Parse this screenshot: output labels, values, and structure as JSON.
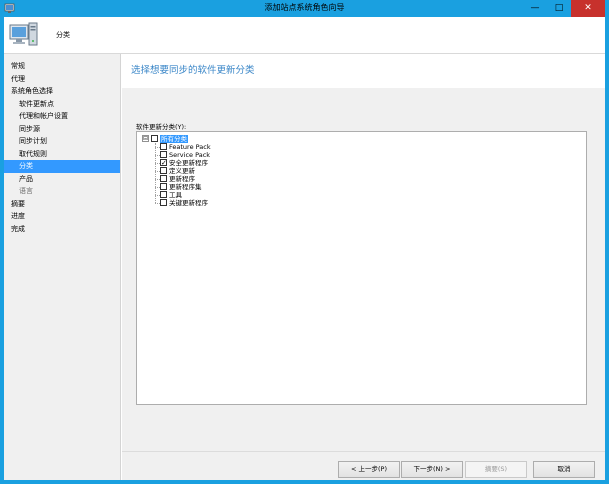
{
  "window": {
    "title": "添加站点系统角色向导",
    "controls": {
      "minimize": "—",
      "maximize": "□",
      "close": "✕"
    }
  },
  "header": {
    "title": "分类",
    "icon": "computer-wizard-icon"
  },
  "nav": {
    "items": [
      {
        "label": "常规",
        "level": 0,
        "state": "normal"
      },
      {
        "label": "代理",
        "level": 0,
        "state": "normal"
      },
      {
        "label": "系统角色选择",
        "level": 0,
        "state": "normal"
      },
      {
        "label": "软件更新点",
        "level": 1,
        "state": "normal"
      },
      {
        "label": "代理和帐户设置",
        "level": 1,
        "state": "normal"
      },
      {
        "label": "同步源",
        "level": 1,
        "state": "normal"
      },
      {
        "label": "同步计划",
        "level": 1,
        "state": "normal"
      },
      {
        "label": "取代规则",
        "level": 1,
        "state": "normal"
      },
      {
        "label": "分类",
        "level": 1,
        "state": "selected"
      },
      {
        "label": "产品",
        "level": 1,
        "state": "normal"
      },
      {
        "label": "语言",
        "level": 1,
        "state": "dim"
      },
      {
        "label": "摘要",
        "level": 0,
        "state": "normal"
      },
      {
        "label": "进度",
        "level": 0,
        "state": "normal"
      },
      {
        "label": "完成",
        "level": 0,
        "state": "normal"
      }
    ]
  },
  "content": {
    "title": "选择想要同步的软件更新分类",
    "field_label": "软件更新分类(Y):",
    "tree": {
      "root": {
        "label": "所有分类",
        "checked": false,
        "expander": "⊟"
      },
      "children": [
        {
          "label": "Feature Pack",
          "checked": false
        },
        {
          "label": "Service Pack",
          "checked": false
        },
        {
          "label": "安全更新程序",
          "checked": true
        },
        {
          "label": "定义更新",
          "checked": false
        },
        {
          "label": "更新程序",
          "checked": false
        },
        {
          "label": "更新程序集",
          "checked": false
        },
        {
          "label": "工具",
          "checked": false
        },
        {
          "label": "关键更新程序",
          "checked": false
        }
      ]
    }
  },
  "footer": {
    "prev": "< 上一步(P)",
    "next": "下一步(N) >",
    "summary": "摘要(S)",
    "cancel": "取消"
  },
  "colors": {
    "titlebar": "#1aa0e0",
    "close": "#c7312c",
    "selection": "#3399ff",
    "heading": "#3b87c8"
  }
}
